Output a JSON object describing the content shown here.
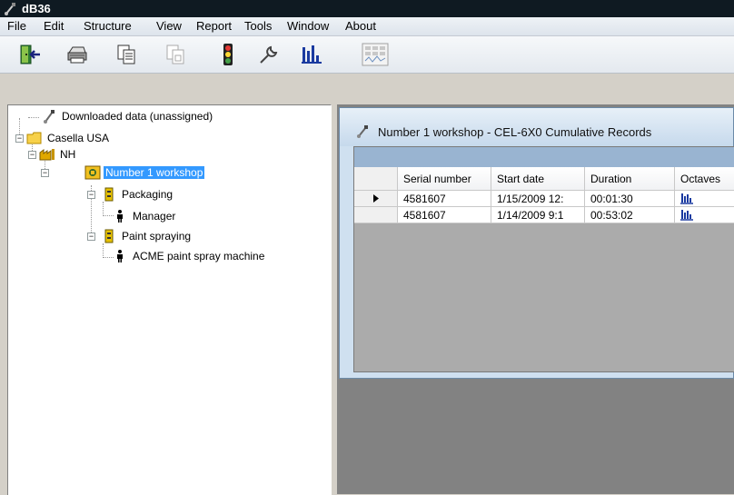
{
  "window": {
    "title": "dB36"
  },
  "menu": [
    "File",
    "Edit",
    "Structure",
    "View",
    "Report",
    "Tools",
    "Window",
    "About"
  ],
  "toolbar": {
    "buttons": [
      {
        "name": "exit-door-icon"
      },
      {
        "name": "printer-icon"
      },
      {
        "name": "copy-report-icon"
      },
      {
        "name": "copy-chart-icon"
      },
      {
        "name": "traffic-light-icon"
      },
      {
        "name": "wrench-icon"
      },
      {
        "name": "bar-chart-icon"
      },
      {
        "name": "calculator-icon"
      }
    ]
  },
  "tree": {
    "nodes": [
      {
        "label": "Downloaded data (unassigned)",
        "icon": "meter-icon"
      },
      {
        "label": "Casella USA",
        "icon": "folder-icon"
      },
      {
        "label": "NH",
        "icon": "factory-icon"
      },
      {
        "label": "Number 1 workshop",
        "icon": "workshop-icon",
        "selected": true
      },
      {
        "label": "Packaging",
        "icon": "process-icon"
      },
      {
        "label": "Manager",
        "icon": "person-icon"
      },
      {
        "label": "Paint spraying",
        "icon": "process-icon"
      },
      {
        "label": "ACME paint spray machine",
        "icon": "person-icon"
      }
    ]
  },
  "records_window": {
    "title": "Number 1 workshop - CEL-6X0 Cumulative Records",
    "columns": [
      "Serial number",
      "Start date",
      "Duration",
      "Octaves"
    ],
    "rows": [
      {
        "serial": "4581607",
        "start": "1/15/2009 12:",
        "duration": "00:01:30",
        "current": true
      },
      {
        "serial": "4581607",
        "start": "1/14/2009 9:1",
        "duration": "00:53:02",
        "current": false
      }
    ]
  },
  "colors": {
    "selection": "#3399ff",
    "mdi_background": "#828282",
    "octave_icon": "#1a3aa0"
  }
}
